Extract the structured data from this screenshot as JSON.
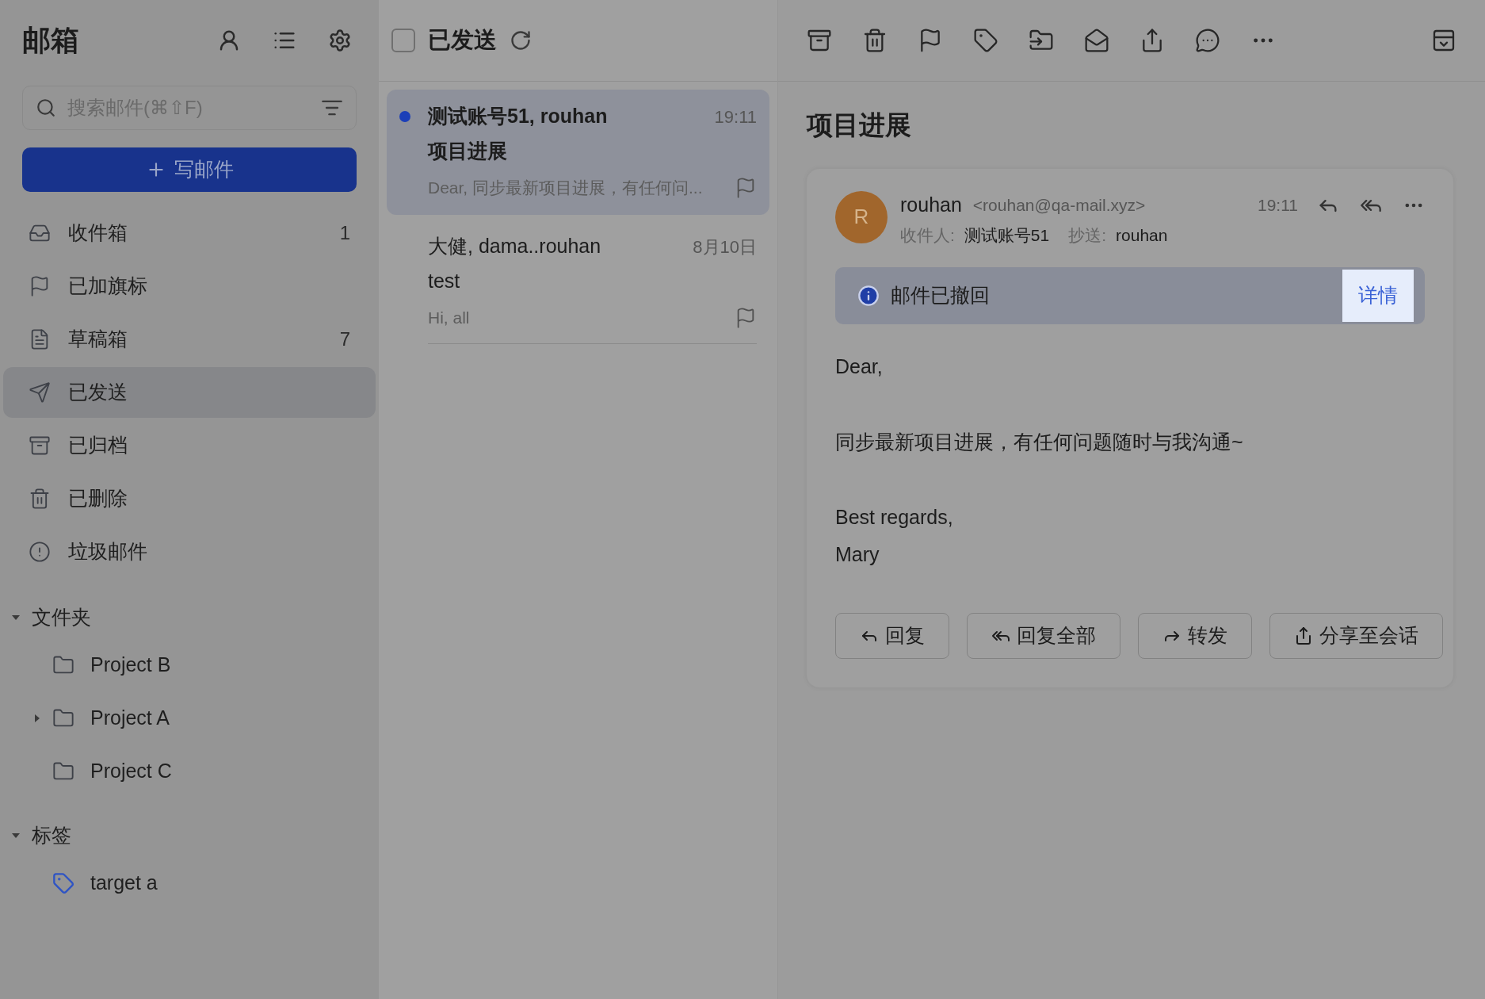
{
  "sidebar": {
    "title": "邮箱",
    "search": {
      "placeholder": "搜索邮件(⌘⇧F)"
    },
    "compose_button": "写邮件",
    "items": [
      {
        "kind": "inbox",
        "label": "收件箱",
        "count": "1",
        "selected": false
      },
      {
        "kind": "flagged",
        "label": "已加旗标",
        "selected": false
      },
      {
        "kind": "drafts",
        "label": "草稿箱",
        "count": "7",
        "selected": false
      },
      {
        "kind": "sent",
        "label": "已发送",
        "selected": true
      },
      {
        "kind": "archive",
        "label": "已归档",
        "selected": false
      },
      {
        "kind": "trash",
        "label": "已删除",
        "selected": false
      },
      {
        "kind": "spam",
        "label": "垃圾邮件",
        "selected": false
      }
    ],
    "sections": [
      {
        "kind": "folders",
        "label": "文件夹",
        "expanded": true,
        "items": [
          {
            "label": "Project B",
            "expandable": false
          },
          {
            "label": "Project A",
            "expandable": true
          },
          {
            "label": "Project C",
            "expandable": false
          }
        ]
      },
      {
        "kind": "tags",
        "label": "标签",
        "expanded": true,
        "items": [
          {
            "label": "target a",
            "color": "#2f54c4"
          }
        ]
      }
    ]
  },
  "mail_list": {
    "title": "已发送",
    "select_all_checked": false,
    "messages": [
      {
        "sender": "测试账号51, rouhan",
        "time": "19:11",
        "subject": "项目进展",
        "preview": "Dear, 同步最新项目进展，有任何问...",
        "unread": true,
        "selected": true
      },
      {
        "sender": "大健, dama..rouhan",
        "time": "8月10日",
        "subject": "test",
        "preview": "Hi, all",
        "unread": false,
        "selected": false
      }
    ]
  },
  "reader": {
    "subject": "项目进展",
    "message": {
      "avatar": "R",
      "sender": "rouhan",
      "email": "<rouhan@qa-mail.xyz>",
      "time": "19:11",
      "to_label": "收件人:",
      "to": "测试账号51",
      "cc_label": "抄送:",
      "cc": "rouhan",
      "notice": {
        "text": "邮件已撤回",
        "action": "详情"
      },
      "body": [
        "Dear,",
        "同步最新项目进展，有任何问题随时与我沟通~",
        "Best regards,",
        "Mary"
      ],
      "actions": [
        {
          "kind": "reply",
          "label": "回复"
        },
        {
          "kind": "reply_all",
          "label": "回复全部"
        },
        {
          "kind": "forward",
          "label": "转发"
        },
        {
          "kind": "share",
          "label": "分享至会话"
        }
      ]
    }
  }
}
